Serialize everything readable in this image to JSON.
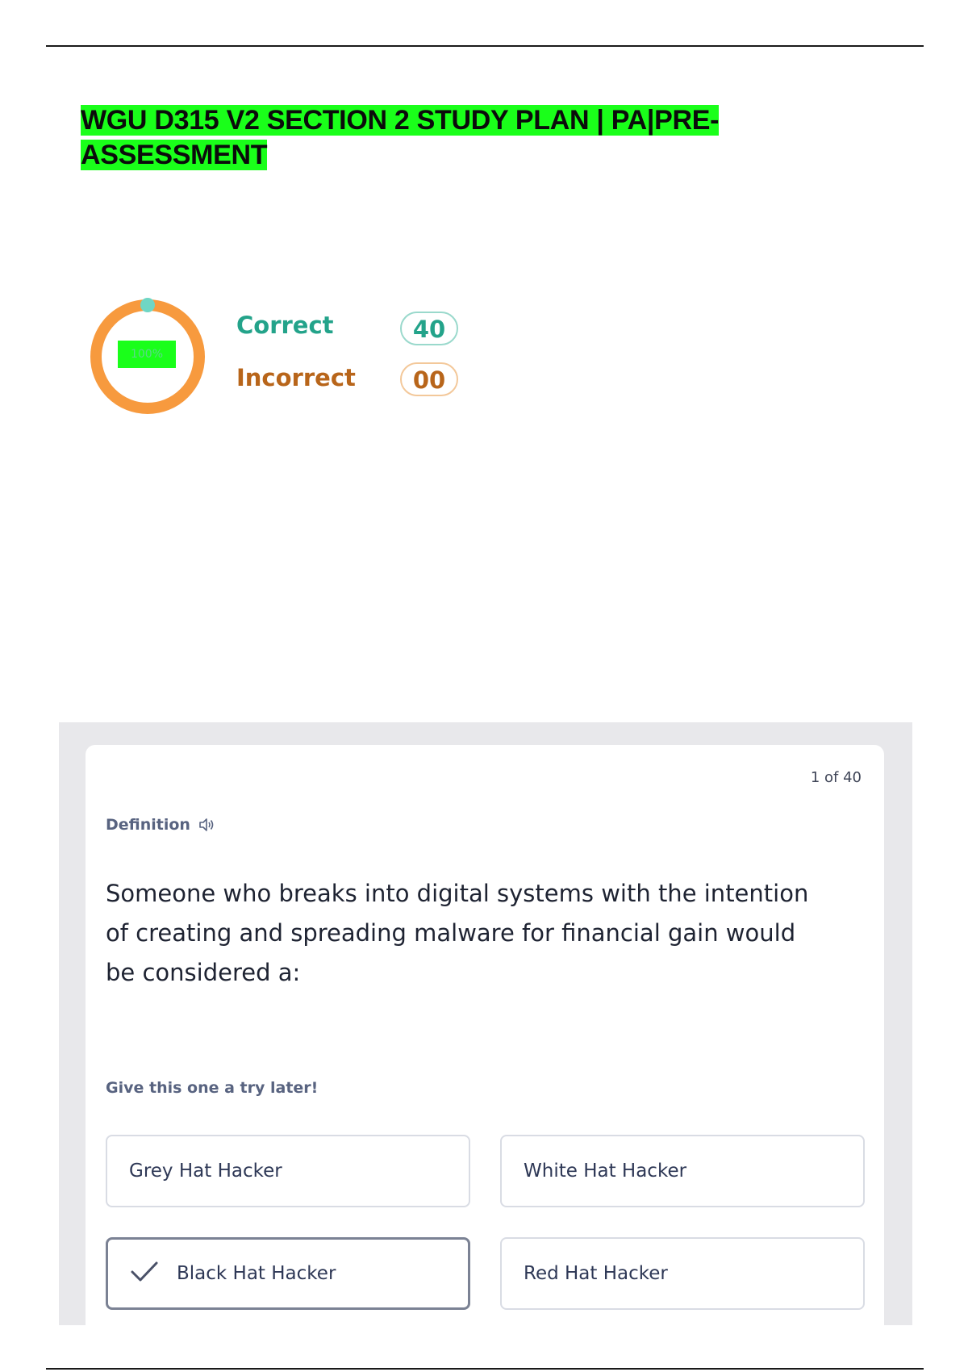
{
  "document": {
    "title": "WGU D315 V2 SECTION 2 STUDY PLAN | PA|PRE-ASSESSMENT"
  },
  "score": {
    "percent": 100,
    "ring_label": "100%",
    "correct_label": "Correct",
    "correct_count": "40",
    "incorrect_label": "Incorrect",
    "incorrect_count": "00",
    "colors": {
      "correct": "#23a38a",
      "incorrect": "#b8651a",
      "ring": "#f79a3e"
    }
  },
  "card": {
    "counter": "1 of 40",
    "term_label": "Definition",
    "audio_icon": "speaker-icon",
    "question": "Someone who breaks into digital systems with the intention of creating and spreading malware for financial gain would be considered  a:",
    "hint": "Give this one a try later!",
    "options": [
      {
        "label": "Grey Hat Hacker",
        "selected": false
      },
      {
        "label": "White Hat Hacker",
        "selected": false
      },
      {
        "label": "Black Hat Hacker",
        "selected": true
      },
      {
        "label": "Red Hat Hacker",
        "selected": false
      }
    ]
  }
}
